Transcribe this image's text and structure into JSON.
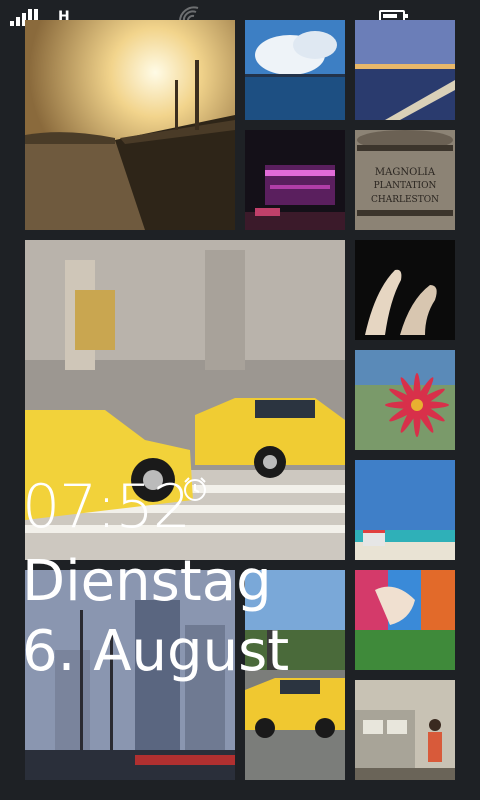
{
  "status_bar": {
    "signal_bars": 4,
    "network_type": "H",
    "wifi_icon": "wifi-icon",
    "battery_level": 0.8
  },
  "lock_screen": {
    "time": "07:52",
    "day": "Dienstag",
    "date": "6. August",
    "alarm_icon": "alarm-clock-icon"
  },
  "photos": [
    {
      "name": "sunset-harbor-photo"
    },
    {
      "name": "lake-clouds-photo"
    },
    {
      "name": "city-dusk-photo"
    },
    {
      "name": "neon-building-photo"
    },
    {
      "name": "barrel-photo",
      "text": "MAGNOLIA PLANTATION CHARLESTON"
    },
    {
      "name": "taxi-street-photo"
    },
    {
      "name": "hands-photo"
    },
    {
      "name": "flower-photo"
    },
    {
      "name": "beach-photo"
    },
    {
      "name": "mural-photo"
    },
    {
      "name": "taxi-overlook-photo"
    },
    {
      "name": "subway-photo"
    },
    {
      "name": "ship-skyline-photo"
    }
  ]
}
